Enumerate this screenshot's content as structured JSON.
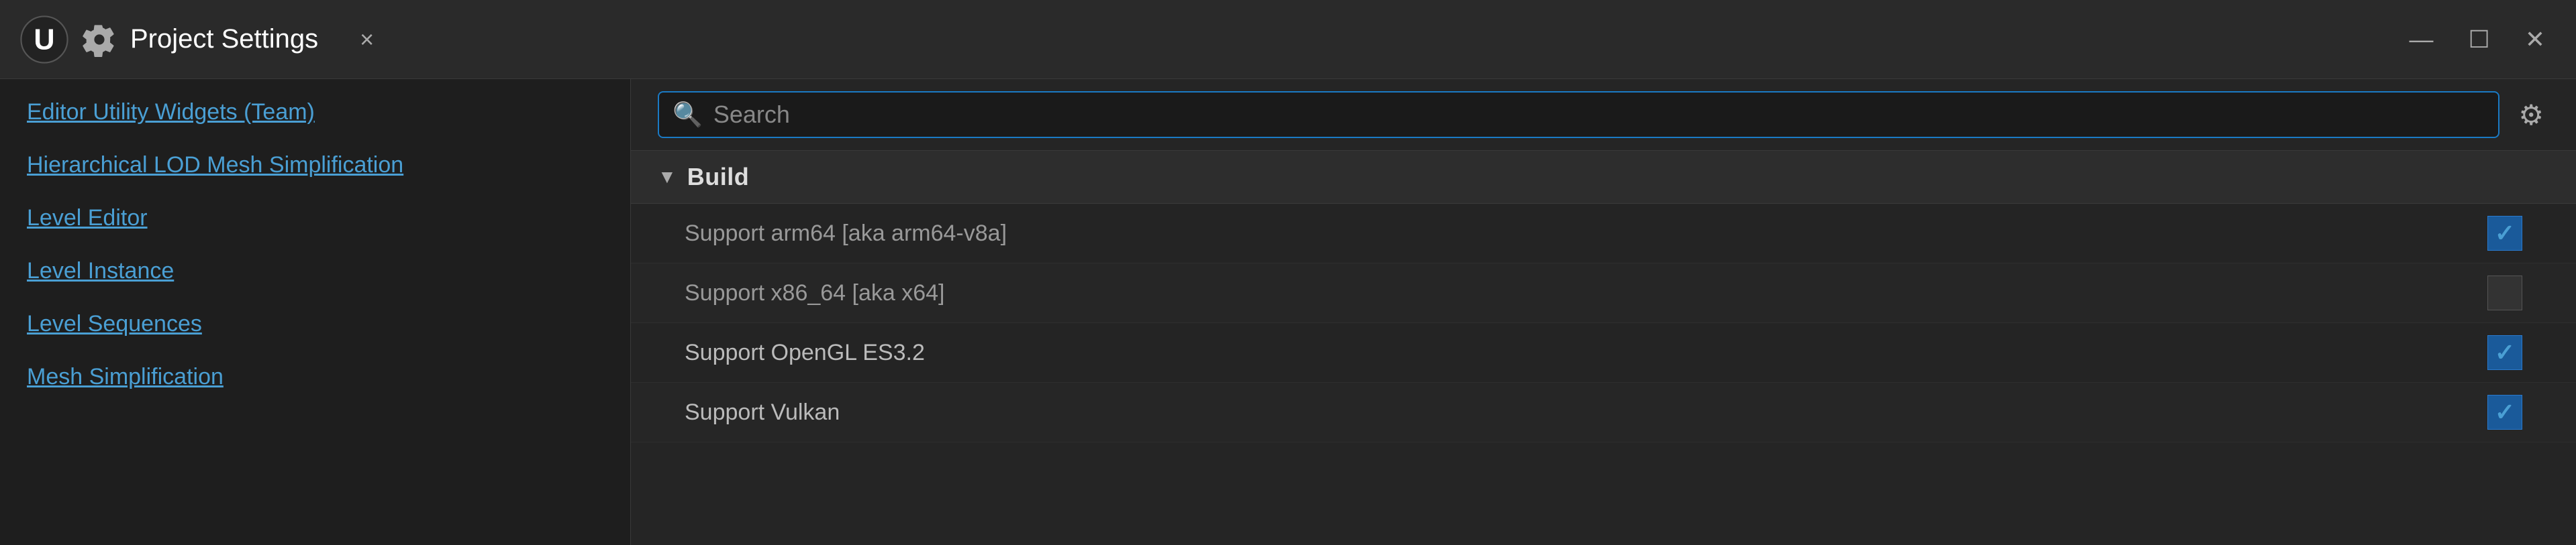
{
  "titlebar": {
    "title": "Project Settings",
    "close_label": "×",
    "minimize_label": "—",
    "maximize_label": "☐",
    "window_close_label": "✕"
  },
  "sidebar": {
    "items": [
      {
        "label": "Editor Utility Widgets (Team)"
      },
      {
        "label": "Hierarchical LOD Mesh Simplification"
      },
      {
        "label": "Level Editor"
      },
      {
        "label": "Level Instance"
      },
      {
        "label": "Level Sequences"
      },
      {
        "label": "Mesh Simplification"
      }
    ]
  },
  "search": {
    "placeholder": "Search",
    "gear_label": "⚙"
  },
  "build_section": {
    "title": "Build",
    "settings": [
      {
        "label": "Support arm64 [aka arm64-v8a]",
        "checked": true,
        "enabled": false
      },
      {
        "label": "Support x86_64 [aka x64]",
        "checked": false,
        "enabled": false
      },
      {
        "label": "Support OpenGL ES3.2",
        "checked": true,
        "enabled": true
      },
      {
        "label": "Support Vulkan",
        "checked": true,
        "enabled": true
      }
    ]
  },
  "icons": {
    "search": "🔍",
    "arrow_down": "▼",
    "gear": "⚙",
    "checkmark": "✓"
  }
}
